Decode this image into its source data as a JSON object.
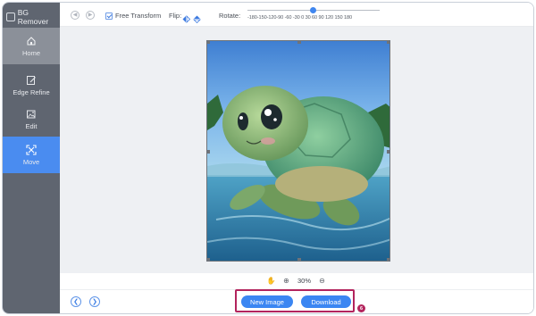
{
  "app": {
    "title": "BG Remover"
  },
  "sidebar": {
    "items": [
      {
        "label": "Home",
        "icon": "home-icon",
        "active": false
      },
      {
        "label": "Edge Refine",
        "icon": "edge-refine-icon",
        "active": false
      },
      {
        "label": "Edit",
        "icon": "image-edit-icon",
        "active": false
      },
      {
        "label": "Move",
        "icon": "move-icon",
        "active": true
      }
    ]
  },
  "toolbar": {
    "free_transform_label": "Free Transform",
    "free_transform_checked": true,
    "flip_label": "Flip:",
    "rotate_label": "Rotate:",
    "rotate_scale": "-180-150-120-90 -60 -30 0 30 60 90 120 150 180",
    "rotate_value": 0
  },
  "canvas": {
    "image_subject": "cartoon sea turtle swimming in ocean"
  },
  "zoom": {
    "value": "30%"
  },
  "actions": {
    "new_image_label": "New Image",
    "download_label": "Download",
    "step_badge": "6"
  },
  "colors": {
    "accent": "#3b86f2",
    "sidebar": "#5f6570",
    "active_item": "#4a8cf0",
    "highlight": "#b3245d"
  }
}
